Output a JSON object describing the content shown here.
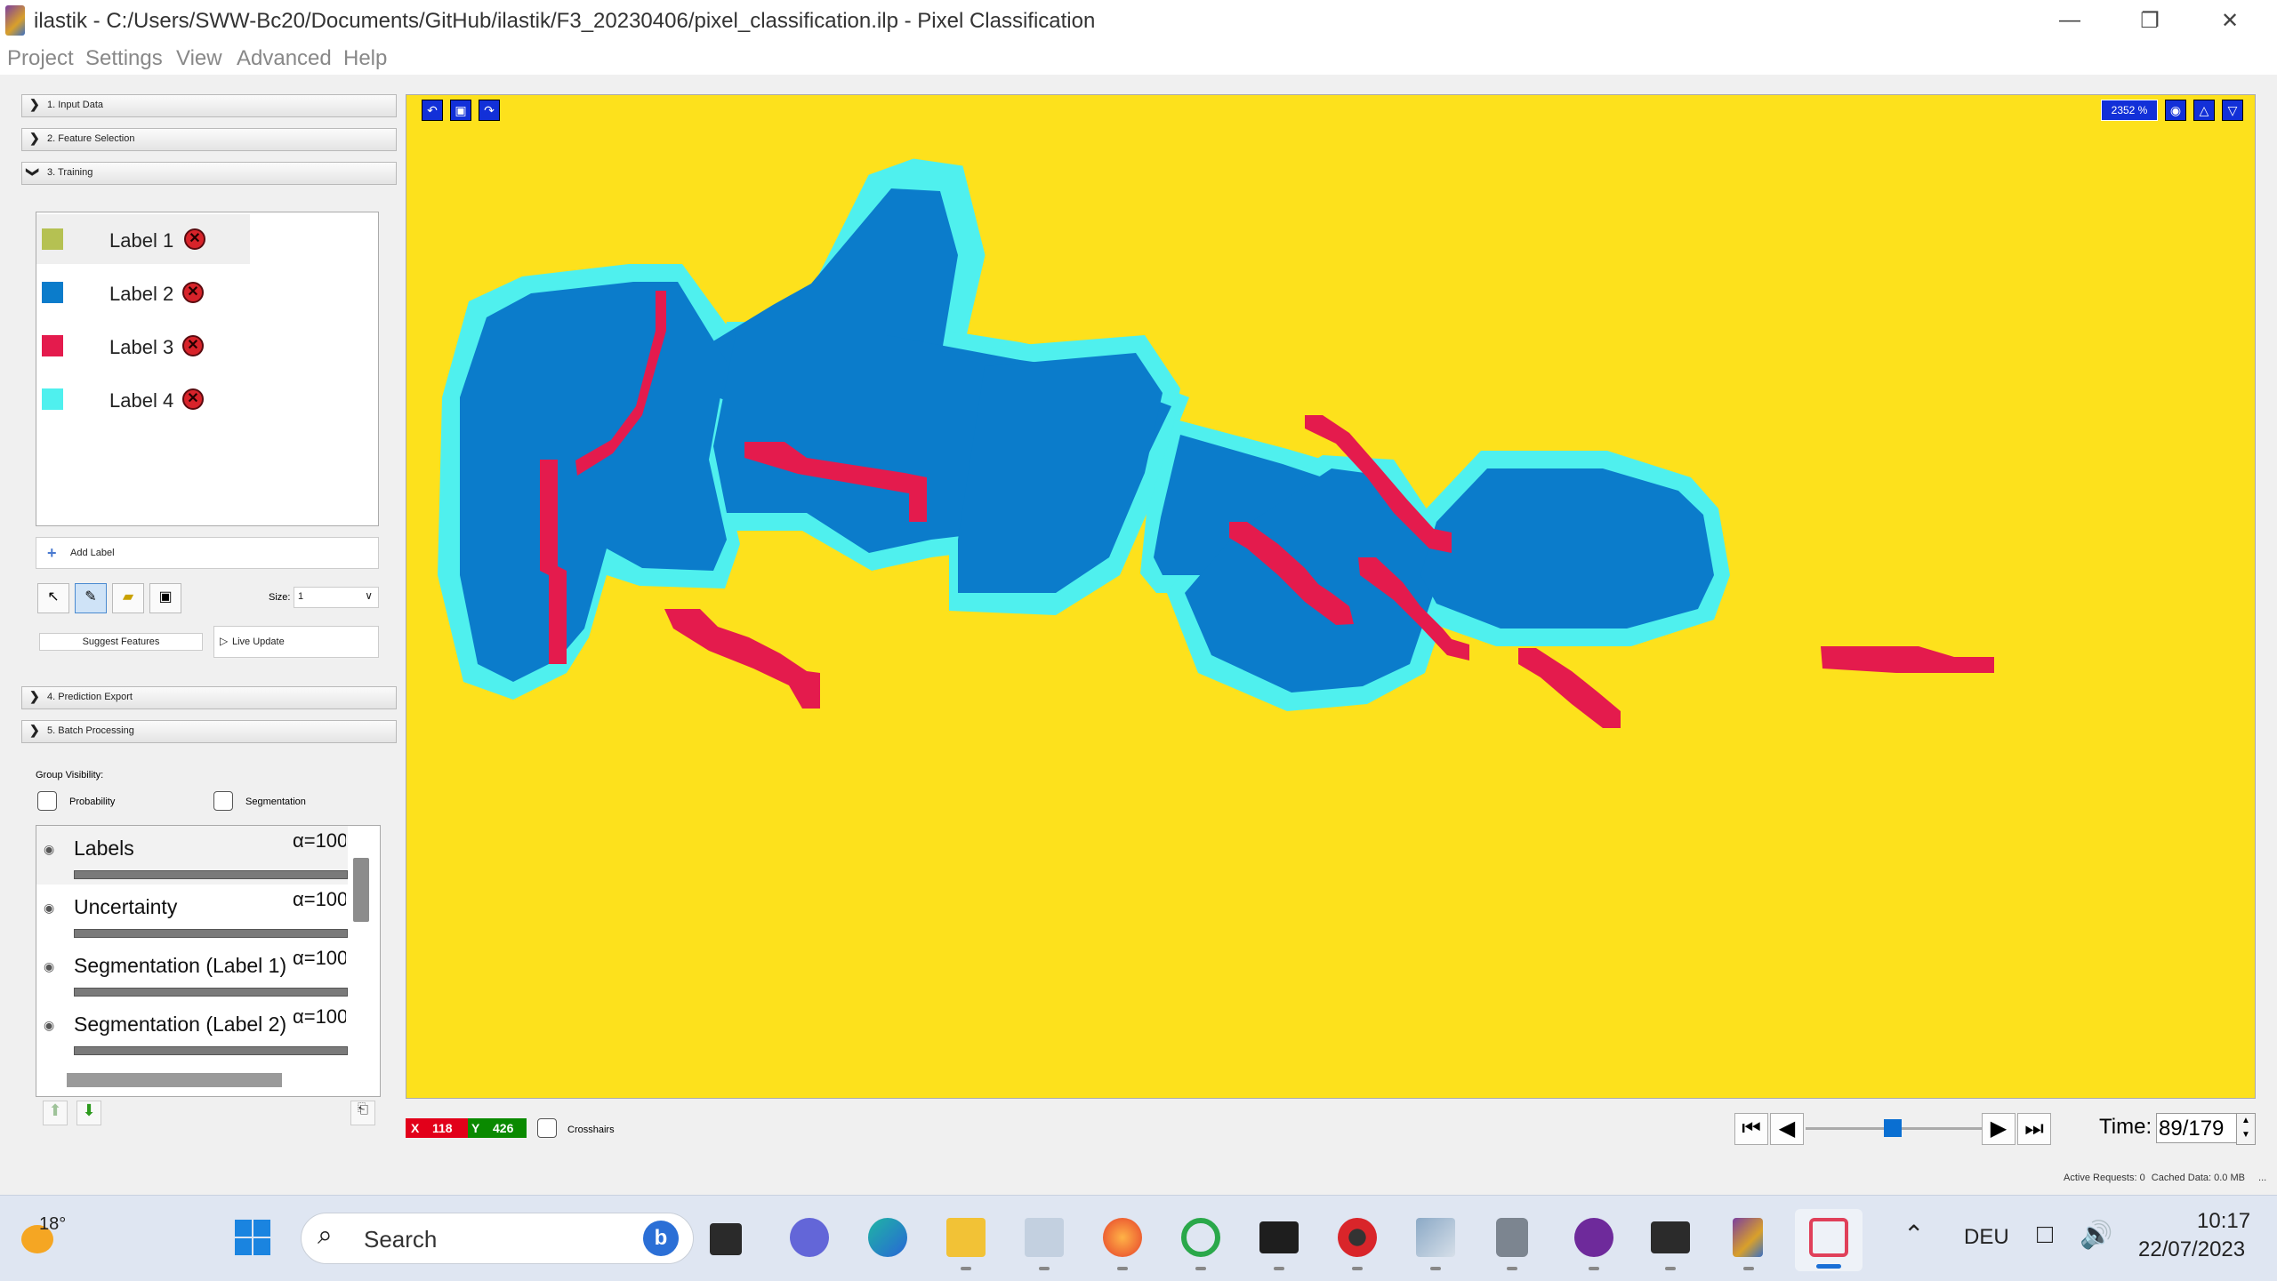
{
  "window": {
    "title": "ilastik - C:/Users/SWW-Bc20/Documents/GitHub/ilastik/F3_20230406/pixel_classification.ilp - Pixel Classification",
    "controls": [
      "minimize-icon",
      "restore-icon",
      "close-icon"
    ]
  },
  "menu": [
    "Project",
    "Settings",
    "View",
    "Advanced",
    "Help"
  ],
  "applets": {
    "input_data": "1. Input Data",
    "feature_selection": "2. Feature Selection",
    "training": "3. Training",
    "prediction_export": "4. Prediction Export",
    "batch_processing": "5. Batch Processing"
  },
  "labels": [
    {
      "name": "Label 1",
      "color": "#b5c152"
    },
    {
      "name": "Label 2",
      "color": "#0b7ccb"
    },
    {
      "name": "Label 3",
      "color": "#e41b4d"
    },
    {
      "name": "Label 4",
      "color": "#4ff0ee"
    }
  ],
  "training": {
    "add_label": "Add Label",
    "size_label": "Size:",
    "size_value": "1",
    "suggest_features": "Suggest Features",
    "live_update": "Live Update"
  },
  "group_visibility": {
    "title": "Group Visibility:",
    "probability": "Probability",
    "segmentation": "Segmentation"
  },
  "layers": [
    {
      "name": "Labels",
      "alpha": "α=100"
    },
    {
      "name": "Uncertainty",
      "alpha": "α=100"
    },
    {
      "name": "Segmentation (Label 1)",
      "alpha": "α=100"
    },
    {
      "name": "Segmentation (Label 2)",
      "alpha": "α=100"
    }
  ],
  "viewer": {
    "zoom": "2352 %",
    "background_color": "#fde11c"
  },
  "status": {
    "x_label": "X",
    "x_value": "118",
    "y_label": "Y",
    "y_value": "426",
    "crosshairs": "Crosshairs",
    "time_label": "Time:",
    "time_value": "89/179",
    "requests": "Active Requests: 0",
    "cached": "Cached Data: 0.0 MB",
    "more": "..."
  },
  "taskbar": {
    "weather_temp": "18°",
    "search_placeholder": "Search",
    "language": "DEU",
    "time": "10:17",
    "date": "22/07/2023"
  }
}
